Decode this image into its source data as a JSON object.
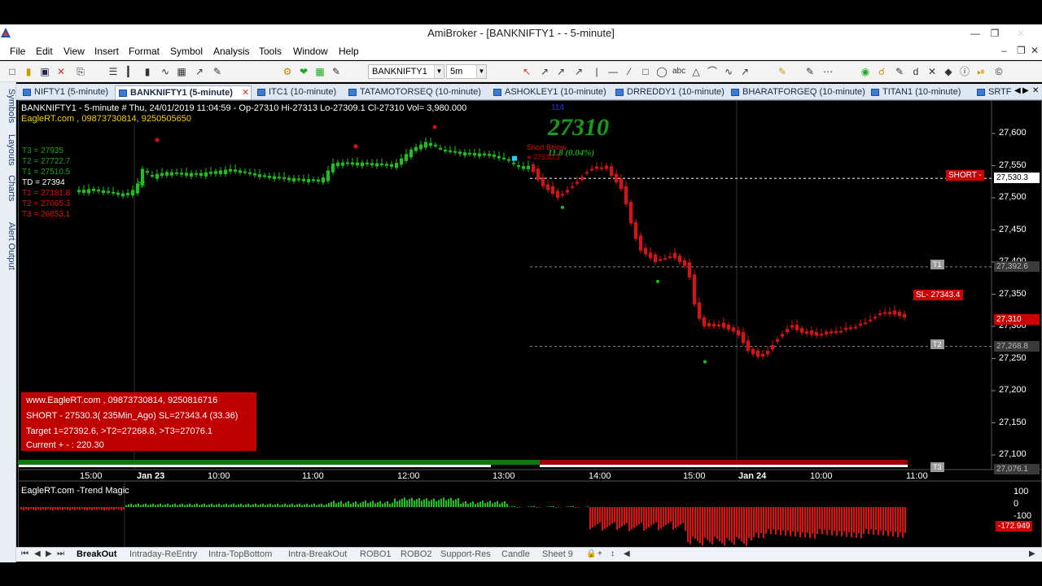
{
  "window": {
    "title": "AmiBroker - [BANKNIFTY1 -  - 5-minute]",
    "min": "—",
    "max": "❐",
    "close": "✕"
  },
  "menu": [
    "File",
    "Edit",
    "View",
    "Insert",
    "Format",
    "Symbol",
    "Analysis",
    "Tools",
    "Window",
    "Help"
  ],
  "toolbar": {
    "symbol": "BANKNIFTY1",
    "interval": "5m"
  },
  "side_tabs": [
    "Symbols",
    "Layouts",
    "Charts",
    "Alert Output"
  ],
  "doc_tabs": [
    {
      "label": "NIFTY1 (5-minute)",
      "active": false
    },
    {
      "label": "BANKNIFTY1 (5-minute)",
      "active": true
    },
    {
      "label": "ITC1 (10-minute)",
      "active": false
    },
    {
      "label": "TATAMOTORSEQ (10-minute)",
      "active": false
    },
    {
      "label": "ASHOKLEY1 (10-minute)",
      "active": false
    },
    {
      "label": "DRREDDY1 (10-minute)",
      "active": false
    },
    {
      "label": "BHARATFORGEQ (10-minute)",
      "active": false
    },
    {
      "label": "TITAN1 (10-minute)",
      "active": false
    },
    {
      "label": "SRTF",
      "active": false
    }
  ],
  "chart": {
    "header": "BANKNIFTY1 - 5-minute  # Thu, 24/01/2019 11:04:59 - Op-27310  Hi-27313  Lo-27309.1  Cl-27310  Vol= 3,980.000",
    "sub_header": "EagleRT.com , 09873730814, 9250505650",
    "targets": [
      {
        "text": "T3 = 27935",
        "color": "#1aa31a"
      },
      {
        "text": "T2 = 27722.7",
        "color": "#1aa31a"
      },
      {
        "text": "T1 = 27510.5",
        "color": "#1aa31a"
      },
      {
        "text": "TD = 27394",
        "color": "#ffffff"
      },
      {
        "text": "T1 = 27181.8",
        "color": "#e01010"
      },
      {
        "text": "T2 = 27065.3",
        "color": "#e01010"
      },
      {
        "text": "T3 = 26853.1",
        "color": "#e01010"
      }
    ],
    "big_price": "27310",
    "bar_count": "114",
    "short_below": "Short Below",
    "short_note": "11.8 (0.04%)",
    "short_price": "27530.3",
    "short_tag": "SHORT -",
    "sl_tag": "SL- 27343.4",
    "t1_box": "T1",
    "t2_box": "T2",
    "t3_box": "T3",
    "info_lines": [
      "www.EagleRT.com , 09873730814, 9250816716",
      "SHORT - 27530.3( 235Min_Ago) SL=27343.4 (33.36)",
      "Target 1=27392.6, >T2=27268.8, >T3=27076.1",
      "Current + - : 220.30"
    ],
    "price_axis": [
      "27,600",
      "27,550",
      "27,500",
      "27,450",
      "27,400",
      "27,350",
      "27,300",
      "27,250",
      "27,200",
      "27,150",
      "27,100"
    ],
    "price_tags": [
      {
        "text": "27,530.3",
        "price": 27530.3,
        "style": "white"
      },
      {
        "text": "27,392.6",
        "price": 27392.6,
        "style": "gray"
      },
      {
        "text": "27,310",
        "price": 27310,
        "style": "red"
      },
      {
        "text": "27,268.8",
        "price": 27268.8,
        "style": "gray"
      },
      {
        "text": "27,076.1",
        "price": 27076.1,
        "style": "gray"
      }
    ],
    "time_axis": [
      {
        "text": "15:00",
        "bold": false
      },
      {
        "text": "Jan 23",
        "bold": true
      },
      {
        "text": "10:00",
        "bold": false
      },
      {
        "text": "11:00",
        "bold": false
      },
      {
        "text": "12:00",
        "bold": false
      },
      {
        "text": "13:00",
        "bold": false
      },
      {
        "text": "14:00",
        "bold": false
      },
      {
        "text": "15:00",
        "bold": false
      },
      {
        "text": "Jan 24",
        "bold": true
      },
      {
        "text": "10:00",
        "bold": false
      },
      {
        "text": "11:00",
        "bold": false
      }
    ],
    "indicator_title": "EagleRT.com -Trend Magic",
    "indicator_axis": [
      "100",
      "0",
      "-100"
    ],
    "indicator_value": "-172.949",
    "colors": {
      "bull": "#18c418",
      "bear": "#e01010",
      "bg": "#000000"
    }
  },
  "sheets": [
    {
      "label": "BreakOut",
      "active": true
    },
    {
      "label": "Intraday-ReEntry",
      "active": false
    },
    {
      "label": "Intra-TopBottom",
      "active": false
    },
    {
      "label": "Intra-BreakOut",
      "active": false
    },
    {
      "label": "ROBO1",
      "active": false
    },
    {
      "label": "ROBO2",
      "active": false
    },
    {
      "label": "Support-Res",
      "active": false
    },
    {
      "label": "Candle",
      "active": false
    },
    {
      "label": "Sheet 9",
      "active": false
    }
  ]
}
